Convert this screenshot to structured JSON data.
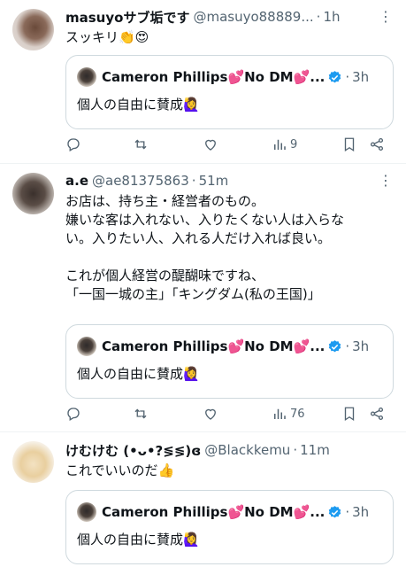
{
  "tweets": [
    {
      "name": "masuyoサブ垢です",
      "handle": "@masuyo88889...",
      "time": "1h",
      "body": [
        "スッキリ👏😍"
      ],
      "quote": {
        "name": "Cameron Phillips💕No DM💕...",
        "time": "3h",
        "text": "個人の自由に賛成🙋‍♀️"
      },
      "views": "9"
    },
    {
      "name": "a.e",
      "handle": "@ae81375863",
      "time": "51m",
      "body": [
        "お店は、持ち主・経営者のもの。",
        "嫌いな客は入れない、入りたくない人は入らな",
        "い。入りたい人、入れる人だけ入れば良い。",
        "",
        "これが個人経営の醍醐味ですね、",
        "「一国一城の主」「キングダム(私の王国)」"
      ],
      "quote": {
        "name": "Cameron Phillips💕No DM💕...",
        "time": "3h",
        "text": "個人の自由に賛成🙋‍♀️"
      },
      "views": "76"
    },
    {
      "name": "けむけむ (•ᴗ•?≶≶)ɞ",
      "handle": "@Blackkemu",
      "time": "11m",
      "body": [
        "これでいいのだ👍"
      ],
      "quote": {
        "name": "Cameron Phillips💕No DM💕...",
        "time": "3h",
        "text": "個人の自由に賛成🙋‍♀️"
      }
    }
  ],
  "icons": [
    "reply-icon",
    "retweet-icon",
    "like-icon",
    "views-icon",
    "bookmark-icon",
    "share-icon",
    "more-icon",
    "verified-badge-icon"
  ],
  "colors": {
    "verified": "#1d9bf0",
    "muted": "#536471",
    "border": "#cfd9de"
  }
}
